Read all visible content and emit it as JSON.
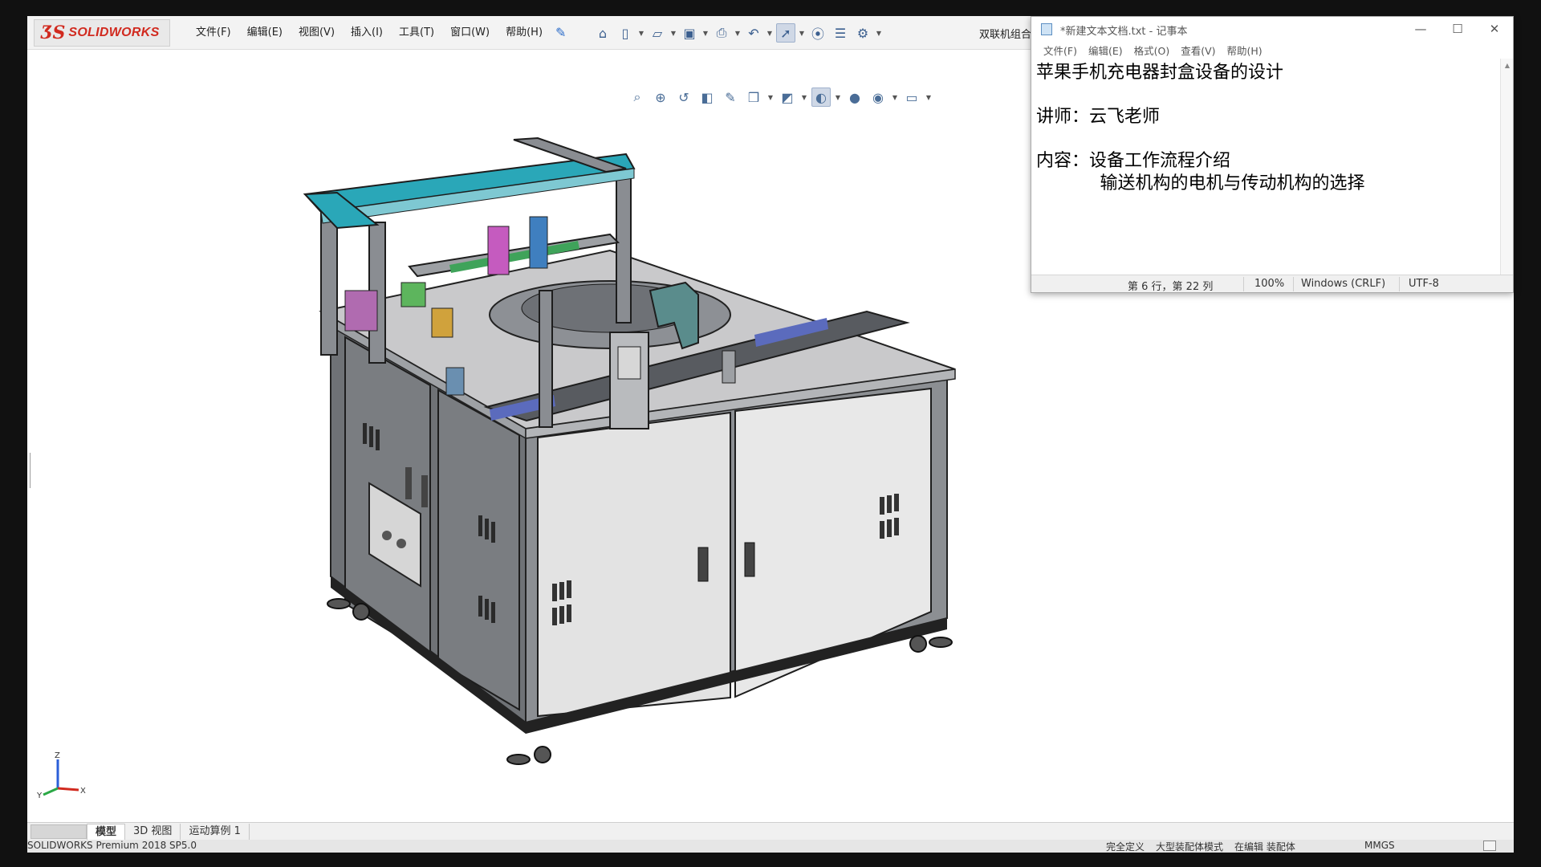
{
  "solidworks": {
    "logo": {
      "mark": "ƷS",
      "text": "SOLIDWORKS"
    },
    "menu": [
      "文件(F)",
      "编辑(E)",
      "视图(V)",
      "插入(I)",
      "工具(T)",
      "窗口(W)",
      "帮助(H)"
    ],
    "document_title": "双联机组合",
    "tabs": {
      "model": "模型",
      "view3d": "3D 视图",
      "motion": "运动算例 1"
    },
    "status": {
      "product": "SOLIDWORKS Premium 2018 SP5.0",
      "fully_defined": "完全定义",
      "large_assembly": "大型装配体模式",
      "editing": "在编辑 装配体",
      "units": "MMGS"
    },
    "toolbar_icons": [
      "home-icon",
      "new-document-icon",
      "open-folder-icon",
      "save-icon",
      "print-icon",
      "undo-icon",
      "select-cursor-icon",
      "traffic-light-icon",
      "file-properties-icon",
      "options-gear-icon"
    ],
    "view_icons": [
      "zoom-to-fit-icon",
      "zoom-area-icon",
      "previous-view-icon",
      "section-view-icon",
      "dynamic-annotation-icon",
      "view-orientation-icon",
      "display-style-icon",
      "hide-show-icon",
      "edit-appearance-icon",
      "apply-scene-icon",
      "view-settings-icon"
    ]
  },
  "notepad": {
    "title": "*新建文本文档.txt - 记事本",
    "menu": [
      "文件(F)",
      "编辑(E)",
      "格式(O)",
      "查看(V)",
      "帮助(H)"
    ],
    "lines": [
      "苹果手机充电器封盒设备的设计",
      "",
      "讲师：云飞老师",
      "",
      "内容：设备工作流程介绍",
      "      输送机构的电机与传动机构的选择"
    ],
    "status": {
      "position": "第 6 行，第 22 列",
      "zoom": "100%",
      "line_ending": "Windows (CRLF)",
      "encoding": "UTF-8"
    },
    "buttons": {
      "minimize": "—",
      "maximize": "☐",
      "close": "✕"
    }
  },
  "colors": {
    "accent_teal": "#2aa7b8",
    "frame_gray": "#8a8d92",
    "panel_light": "#e6e6e6",
    "solidworks_red": "#d12a1f"
  }
}
